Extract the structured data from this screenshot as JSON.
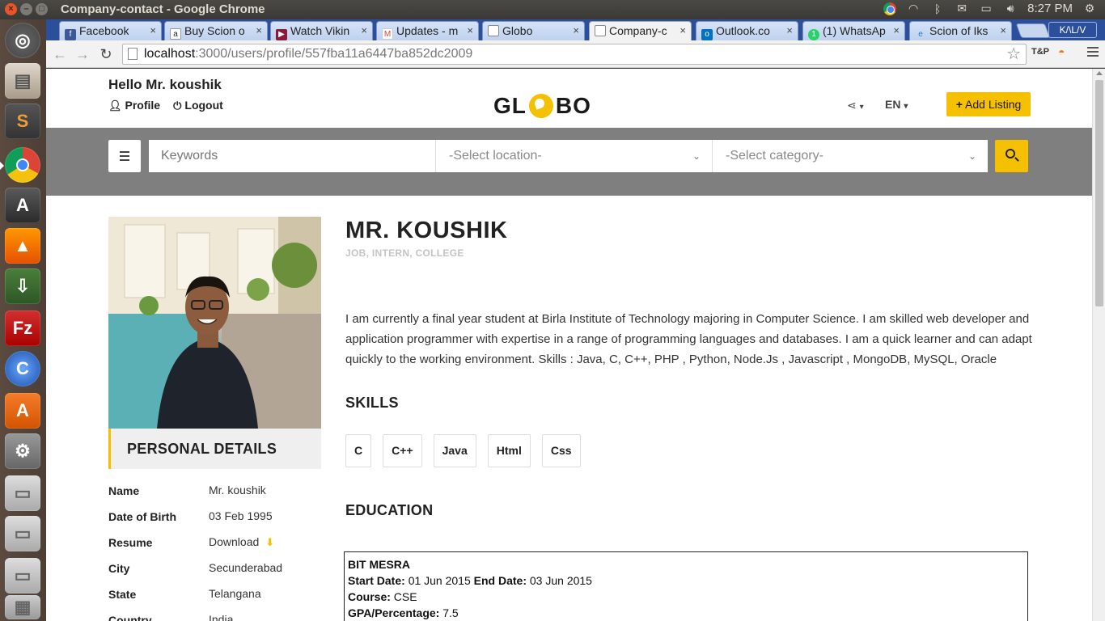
{
  "os": {
    "window_title": "Company-contact - Google Chrome",
    "clock": "8:27 PM"
  },
  "browser": {
    "tabs": [
      {
        "label": "Facebook",
        "icon": "facebook-icon",
        "color": "#3b5998"
      },
      {
        "label": "Buy Scion o",
        "icon": "amazon-icon",
        "color": "#222222"
      },
      {
        "label": "Watch Vikin",
        "icon": "video-icon",
        "color": "#8b1a3a"
      },
      {
        "label": "Updates - m",
        "icon": "gmail-icon",
        "color": "#d44638"
      },
      {
        "label": "Globo",
        "icon": "page-icon",
        "color": "#ffffff"
      },
      {
        "label": "Company-c",
        "icon": "page-icon",
        "color": "#ffffff"
      },
      {
        "label": "Outlook.co",
        "icon": "outlook-icon",
        "color": "#0072c6"
      },
      {
        "label": "(1) WhatsAp",
        "icon": "whatsapp-icon",
        "color": "#25d366"
      },
      {
        "label": "Scion of Iks",
        "icon": "ie-icon",
        "color": "#1e7bd3"
      }
    ],
    "profile_badge": "K/\\L/V",
    "url_host": "localhost",
    "url_path": ":3000/users/profile/557fba11a6447ba852dc2009"
  },
  "header": {
    "greeting": "Hello Mr. koushik",
    "profile_link": "Profile",
    "logout_link": "Logout",
    "logo_left": "GL",
    "logo_right": "BO",
    "language": "EN",
    "add_listing": "Add Listing"
  },
  "search": {
    "keywords_placeholder": "Keywords",
    "location_select": "-Select location-",
    "category_select": "-Select category-"
  },
  "profile": {
    "name": "MR. KOUSHIK",
    "tags": "JOB, INTERN, COLLEGE",
    "bio": "I am currently a final year student at Birla Institute of Technology majoring in Computer Science. I am skilled web developer and application programmer with expertise in a range of programming languages and databases. I am a quick learner and can adapt quickly to the working environment. Skills : Java, C, C++, PHP , Python, Node.Js , Javascript , MongoDB, MySQL, Oracle",
    "skills_title": "SKILLS",
    "skills": [
      "C",
      "C++",
      "Java",
      "Html",
      "Css"
    ],
    "education_title": "EDUCATION",
    "education": {
      "school": "BIT MESRA",
      "start_label": "Start Date:",
      "start": "01 Jun 2015",
      "end_label": "End Date:",
      "end": "03 Jun 2015",
      "course_label": "Course:",
      "course": "CSE",
      "gpa_label": "GPA/Percentage:",
      "gpa": "7.5"
    }
  },
  "personal_details": {
    "title": "PERSONAL DETAILS",
    "rows": [
      {
        "label": "Name",
        "value": "Mr. koushik"
      },
      {
        "label": "Date of Birth",
        "value": "03 Feb 1995"
      },
      {
        "label": "Resume",
        "value": "Download"
      },
      {
        "label": "City",
        "value": "Secunderabad"
      },
      {
        "label": "State",
        "value": "Telangana"
      },
      {
        "label": "Country",
        "value": "India"
      }
    ]
  },
  "colors": {
    "accent": "#f5c000",
    "search_band": "#7f7f7f"
  }
}
